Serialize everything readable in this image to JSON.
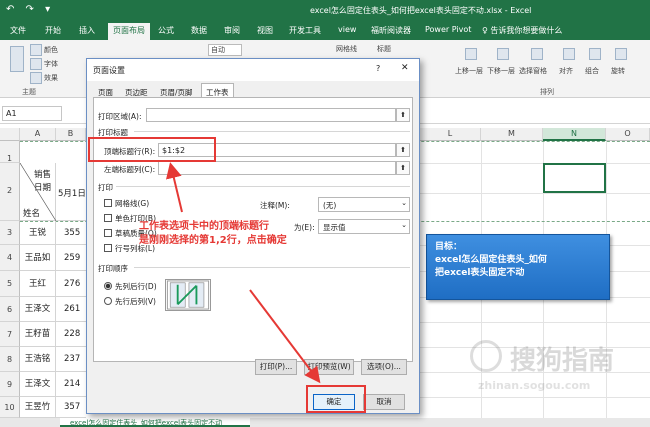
{
  "window": {
    "title": "excel怎么固定住表头_如何把excel表头固定不动.xlsx  -  Excel",
    "qat": "↶ ↷ ▾"
  },
  "ribbon_tabs": [
    "文件",
    "开始",
    "插入",
    "页面布局",
    "公式",
    "数据",
    "审阅",
    "视图",
    "开发工具",
    "view",
    "福昕阅读器",
    "Power Pivot",
    "♀ 告诉我你想要做什么"
  ],
  "ribbon": {
    "theme_items": [
      "颜色",
      "字体",
      "效果"
    ],
    "theme_group": "主题",
    "gridlines": "网格线",
    "headings": "标题",
    "auto": "自动",
    "arrange_items": [
      "上移一层",
      "下移一层",
      "选择窗格",
      "对齐",
      "组合",
      "旋转"
    ],
    "arrange_group": "排列"
  },
  "formula": {
    "namebox": "A1"
  },
  "columns": [
    "A",
    "B",
    "L",
    "M",
    "N",
    "O"
  ],
  "rows": [
    {
      "num": "1",
      "name": "",
      "val": ""
    },
    {
      "num": "2",
      "name": "销售日期",
      "val": "5月1日"
    },
    {
      "num": "3",
      "name": "王锐",
      "val": "355"
    },
    {
      "num": "4",
      "name": "王品如",
      "val": "259"
    },
    {
      "num": "5",
      "name": "王红",
      "val": "276"
    },
    {
      "num": "6",
      "name": "王泽文",
      "val": "261"
    },
    {
      "num": "7",
      "name": "王籽苗",
      "val": "228"
    },
    {
      "num": "8",
      "name": "王浩铭",
      "val": "237"
    },
    {
      "num": "9",
      "name": "王泽文",
      "val": "214"
    },
    {
      "num": "10",
      "name": "王昱竹",
      "val": "357"
    }
  ],
  "header_cell": {
    "line1": "销售",
    "line2": "日期",
    "line3": "姓名"
  },
  "dialog": {
    "title": "页面设置",
    "help": "?",
    "close": "✕",
    "tabs": [
      "页面",
      "页边距",
      "页眉/页脚",
      "工作表"
    ],
    "print_area_label": "打印区域(A):",
    "print_titles_section": "打印标题",
    "top_rows_label": "顶端标题行(R):",
    "top_rows_value": "$1:$2",
    "left_cols_label": "左端标题列(C):",
    "print_section": "打印",
    "checks": [
      "网格线(G)",
      "单色打印(B)",
      "草稿质量(Q)",
      "行号列标(L)"
    ],
    "comments_label": "注释(M):",
    "comments_value": "(无)",
    "errors_label": "为(E):",
    "errors_value": "显示值",
    "page_order_section": "打印顺序",
    "radio_down_then_over": "先列后行(D)",
    "radio_over_then_down": "先行后列(V)",
    "btn_print": "打印(P)...",
    "btn_preview": "打印预览(W)",
    "btn_options": "选项(O)...",
    "btn_ok": "确定",
    "btn_cancel": "取消"
  },
  "annotation": {
    "line1": "工作表选项卡中的顶端标题行",
    "line2": "是刚刚选择的第1,2行，点击确定"
  },
  "tooltip": {
    "line1": "目标：",
    "line2": "excel怎么固定住表头_如何",
    "line3": "把excel表头固定不动"
  },
  "watermark": {
    "text": "搜狗指南",
    "sub": "zhinan.sogou.com"
  },
  "sheet_tab": "excel怎么固定住表头_如何把excel表头固定不动",
  "colors": {
    "excel_green": "#217346",
    "annotation_red": "#e53935",
    "tooltip_blue": "#2a7bd4"
  }
}
